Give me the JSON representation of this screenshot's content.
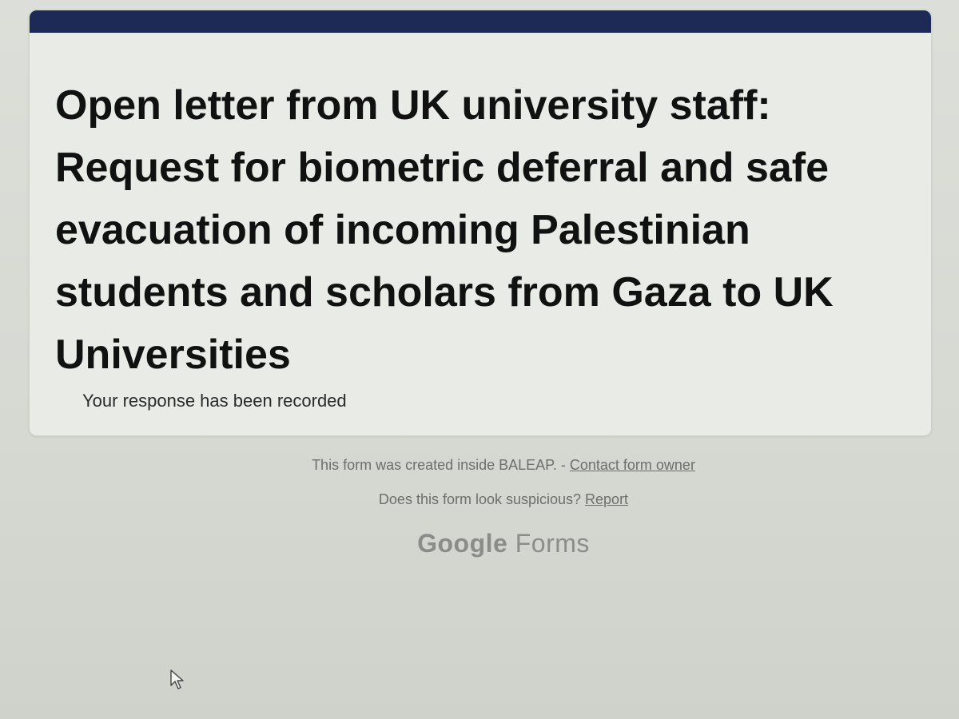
{
  "form": {
    "title": "Open letter from UK university staff: Request for biometric deferral and safe evacuation of incoming Palestinian students and scholars from Gaza to UK Universities",
    "confirmation": "Your response has been recorded"
  },
  "footer": {
    "created_text": "This form was created inside BALEAP. - ",
    "contact_link": "Contact form owner",
    "suspicious_text": "Does this form look suspicious? ",
    "report_link": "Report"
  },
  "brand": {
    "google": "Google",
    "forms": "Forms"
  },
  "colors": {
    "accent": "#1c2a55",
    "background": "#d9dcd6",
    "card": "#e9ebe6"
  },
  "icons": {
    "cursor": "mouse-pointer-icon"
  }
}
